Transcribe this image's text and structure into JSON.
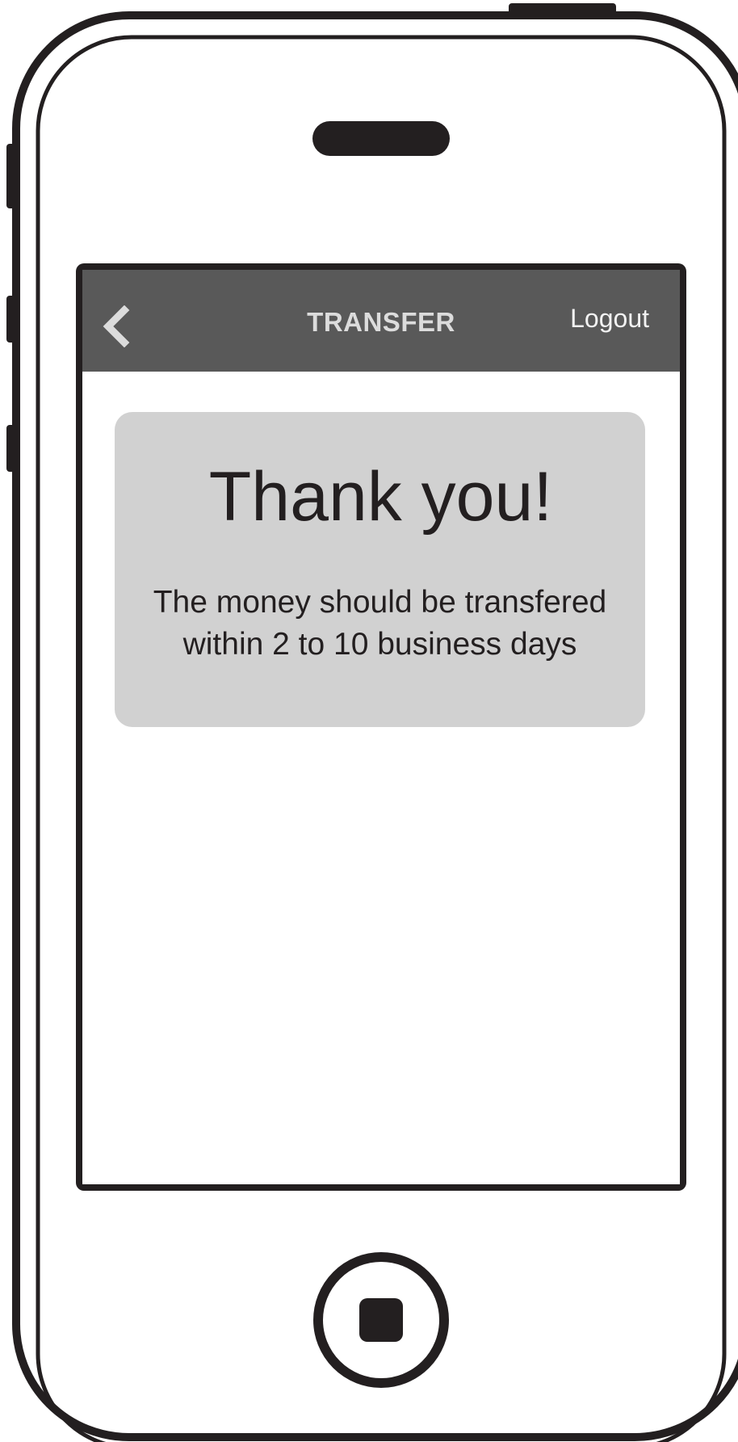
{
  "header": {
    "title": "TRANSFER",
    "back_icon": "chevron-left-icon",
    "logout_label": "Logout"
  },
  "confirmation": {
    "heading": "Thank you!",
    "line1": "The money should be transfered",
    "line2": "within 2 to 10 business days"
  },
  "colors": {
    "device_outline": "#231f20",
    "nav_bar": "#595959",
    "nav_title": "#dcdcdc",
    "card_background": "#d1d1d1",
    "text": "#231f20"
  }
}
